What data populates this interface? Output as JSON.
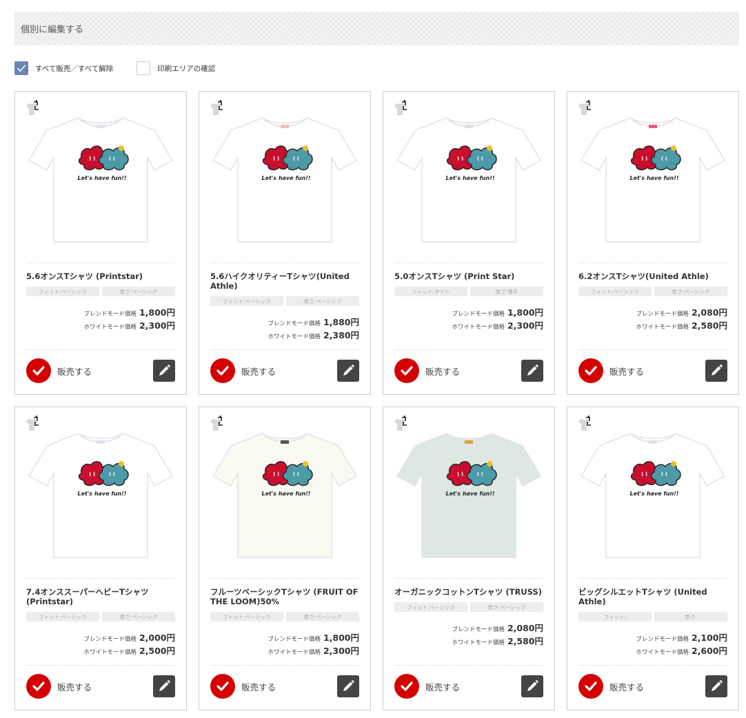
{
  "header": {
    "title": "個別に編集する"
  },
  "controls": {
    "sell_all_label": "すべて販売／すべて解除",
    "sell_all_checked": true,
    "print_area_label": "印刷エリアの確認",
    "print_area_checked": false
  },
  "labels": {
    "blend": "ブレンドモード価格",
    "white": "ホワイトモード価格",
    "sell": "販売する"
  },
  "colors": {
    "accent_red": "#d40000",
    "checkbox_blue": "#6b86b3",
    "edit_button": "#444444"
  },
  "products": [
    {
      "name": "5.6オンスTシャツ (Printstar)",
      "fit": "フィット:ベーシック",
      "thickness": "厚さ:ベーシック",
      "blend_price": "1,800円",
      "white_price": "2,300円",
      "shirt_color": "#ffffff",
      "tag_color": "#e0e0f0"
    },
    {
      "name": "5.6ハイクオリティーTシャツ(United Athle)",
      "fit": "フィット:ベーシック",
      "thickness": "厚さ:ベーシック",
      "blend_price": "1,880円",
      "white_price": "2,380円",
      "shirt_color": "#ffffff",
      "tag_color": "#e8c0c0"
    },
    {
      "name": "5.0オンスTシャツ (Print Star)",
      "fit": "フィット:タイト",
      "thickness": "厚さ:薄手",
      "blend_price": "1,800円",
      "white_price": "2,300円",
      "shirt_color": "#ffffff",
      "tag_color": "#e0e0e0"
    },
    {
      "name": "6.2オンスTシャツ(United Athle)",
      "fit": "フィット:ベーシック",
      "thickness": "厚さ:ベーシック",
      "blend_price": "2,080円",
      "white_price": "2,580円",
      "shirt_color": "#ffffff",
      "tag_color": "#e06080"
    },
    {
      "name": "7.4オンススーパーヘビーTシャツ(Printstar)",
      "fit": "フィット:ベーシック",
      "thickness": "厚さ:ベーシック",
      "blend_price": "2,000円",
      "white_price": "2,500円",
      "shirt_color": "#ffffff",
      "tag_color": "#e0e0f0"
    },
    {
      "name": "フルーツベーシックTシャツ (FRUIT OF THE LOOM)50%",
      "fit": "フィット:ベーシック",
      "thickness": "厚さ:ベーシック",
      "blend_price": "1,800円",
      "white_price": "2,300円",
      "shirt_color": "#fafaf2",
      "tag_color": "#555555"
    },
    {
      "name": "オーガニックコットンTシャツ (TRUSS)",
      "fit": "フィット:ベーシック",
      "thickness": "厚さ:ベーシック",
      "blend_price": "2,080円",
      "white_price": "2,580円",
      "shirt_color": "#dde8e2",
      "tag_color": "#e0a040"
    },
    {
      "name": "ビッグシルエットTシャツ (United Athle)",
      "fit": "フィット:",
      "thickness": "厚さ:",
      "blend_price": "2,100円",
      "white_price": "2,600円",
      "shirt_color": "#ffffff",
      "tag_color": "#e0e0e0"
    }
  ]
}
